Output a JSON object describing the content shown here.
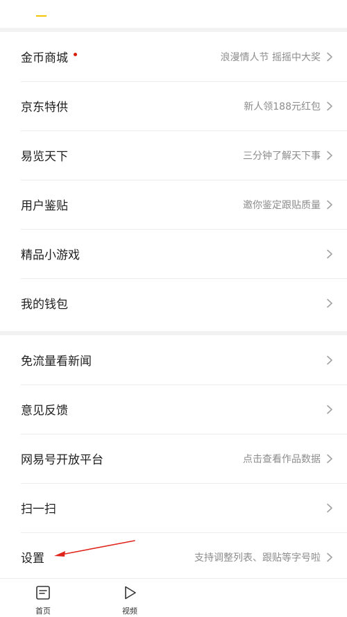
{
  "menu_section_1": [
    {
      "label": "金币商城",
      "hint": "浪漫情人节 摇摇中大奖",
      "dot": true
    },
    {
      "label": "京东特供",
      "hint": "新人领188元红包",
      "dot": false
    },
    {
      "label": "易览天下",
      "hint": "三分钟了解天下事",
      "dot": false
    },
    {
      "label": "用户鉴贴",
      "hint": "邀你鉴定跟贴质量",
      "dot": false
    },
    {
      "label": "精品小游戏",
      "hint": "",
      "dot": false
    },
    {
      "label": "我的钱包",
      "hint": "",
      "dot": false
    }
  ],
  "menu_section_2": [
    {
      "label": "免流量看新闻",
      "hint": ""
    },
    {
      "label": "意见反馈",
      "hint": ""
    },
    {
      "label": "网易号开放平台",
      "hint": "点击查看作品数据"
    },
    {
      "label": "扫一扫",
      "hint": ""
    },
    {
      "label": "设置",
      "hint": "支持调整列表、跟贴等字号啦"
    }
  ],
  "tabbar": {
    "home_label": "首页",
    "video_label": "视频"
  },
  "colors": {
    "notification_dot": "#d81e06",
    "annotation_arrow": "#e0241b",
    "accent": "#f5c400"
  },
  "icons": {
    "chevron": "chevron-right-icon",
    "home": "news-page-icon",
    "video": "play-icon"
  }
}
